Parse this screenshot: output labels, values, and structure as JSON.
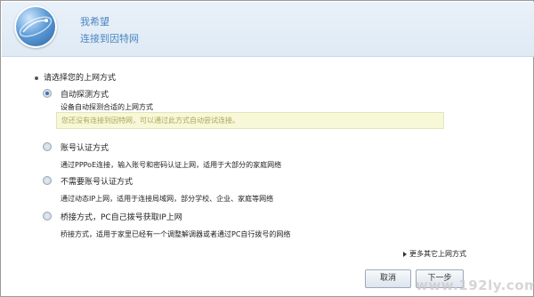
{
  "header": {
    "title": "我希望",
    "subtitle": "连接到因特网"
  },
  "section": {
    "heading": "请选择您的上网方式"
  },
  "options": [
    {
      "title": "自动探测方式",
      "description": "设备自动探测合适的上网方式",
      "hint": "您还没有连接到因特网，可以通过此方式自动尝试连接。",
      "checked": true
    },
    {
      "title": "账号认证方式",
      "description": "通过PPPoE连接，输入账号和密码认证上网，适用于大部分的家庭网络",
      "checked": false
    },
    {
      "title": "不需要账号认证方式",
      "description": "通过动态IP上网，适用于连接局域网，部分学校、企业、家庭等网络",
      "checked": false
    },
    {
      "title": "桥接方式，PC自己拨号获取IP上网",
      "description": "桥接方式，适用于家里已经有一个调整解调器或者通过PC自行拨号的网络",
      "checked": false
    }
  ],
  "links": {
    "more": "更多其它上网方式"
  },
  "buttons": {
    "cancel": "取消",
    "next": "下一步"
  },
  "watermark": "www.192ly.com",
  "colors": {
    "accent": "#4d86c2",
    "hint_bg": "#f6f8d8",
    "hint_text": "#b0a55a"
  }
}
